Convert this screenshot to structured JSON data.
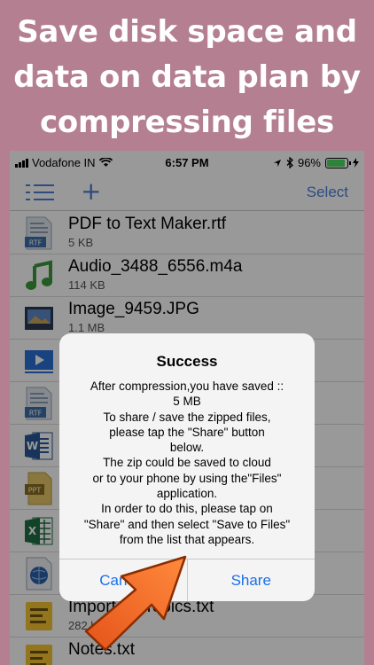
{
  "promo": {
    "line1": "Save disk space and",
    "line2": "data on data plan by",
    "line3": "compressing files"
  },
  "status_bar": {
    "carrier": "Vodafone IN",
    "time": "6:57 PM",
    "battery": "96%"
  },
  "navbar": {
    "menu_icon": "list-icon",
    "add_icon": "plus-icon",
    "select_label": "Select"
  },
  "files": [
    {
      "name": "PDF to Text Maker.rtf",
      "size": "5 KB",
      "icon": "rtf-file-icon"
    },
    {
      "name": "Audio_3488_6556.m4a",
      "size": "114 KB",
      "icon": "music-note-icon"
    },
    {
      "name": "Image_9459.JPG",
      "size": "1.1 MB",
      "icon": "image-file-icon"
    },
    {
      "name": "",
      "size": "",
      "icon": "video-file-icon"
    },
    {
      "name": "",
      "size": "",
      "icon": "rtf-file-icon"
    },
    {
      "name": "",
      "size": "",
      "icon": "word-file-icon"
    },
    {
      "name": "",
      "size": "",
      "icon": "ppt-file-icon"
    },
    {
      "name": "",
      "size": "",
      "icon": "excel-file-icon"
    },
    {
      "name": "",
      "size": "",
      "icon": "web-file-icon"
    },
    {
      "name": "Important Topics.txt",
      "size": "282 bytes",
      "icon": "text-file-icon"
    },
    {
      "name": "Notes.txt",
      "size": "",
      "icon": "text-file-icon"
    }
  ],
  "alert": {
    "title": "Success",
    "message": [
      "After compression,you have saved ::",
      "5 MB",
      "To share / save the zipped files,",
      "please tap the \"Share\" button",
      "below.",
      "The zip could be saved to cloud",
      "or to your phone by using the\"Files\"",
      "application.",
      "In order to do this, please tap on",
      "\"Share\" and then select \"Save to Files\"",
      "from the list that appears."
    ],
    "cancel_label": "Cancel",
    "share_label": "Share"
  },
  "colors": {
    "background": "#b47f90",
    "accent": "#1a6fe8",
    "arrow": "#f26b1d"
  }
}
